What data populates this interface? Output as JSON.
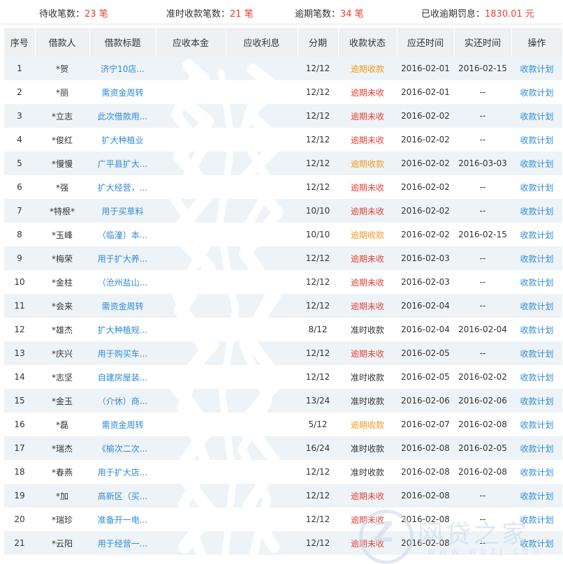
{
  "summary": {
    "pending_label": "待收笔数：",
    "pending_value": "23 笔",
    "ontime_label": "准时收款笔数：",
    "ontime_value": "21 笔",
    "overdue_label": "逾期笔数：",
    "overdue_value": "34 笔",
    "penalty_label": "已收逾期罚息：",
    "penalty_value": "1830.01 元"
  },
  "table": {
    "headers": [
      "序号",
      "借款人",
      "借款标题",
      "应收本金",
      "应收利息",
      "分期",
      "收款状态",
      "应还时间",
      "实还时间",
      "操作"
    ],
    "rows": [
      {
        "no": "1",
        "borrower": "*贺",
        "title": "济宁10店...",
        "principal": "",
        "interest": "",
        "term": "12/12",
        "status": "逾期收款",
        "status_kind": "overdue-paid",
        "due": "2016-02-01",
        "paid": "2016-02-15",
        "action": "收款计划"
      },
      {
        "no": "2",
        "borrower": "*丽",
        "title": "需资金周转",
        "principal": "",
        "interest": "",
        "term": "12/12",
        "status": "逾期未收",
        "status_kind": "overdue-unpaid",
        "due": "2016-02-01",
        "paid": "--",
        "action": "收款计划"
      },
      {
        "no": "3",
        "borrower": "*立志",
        "title": "此次借款用...",
        "principal": "",
        "interest": "",
        "term": "12/12",
        "status": "逾期未收",
        "status_kind": "overdue-unpaid",
        "due": "2016-02-02",
        "paid": "--",
        "action": "收款计划"
      },
      {
        "no": "4",
        "borrower": "*俊红",
        "title": "扩大种植业",
        "principal": "",
        "interest": "",
        "term": "12/12",
        "status": "逾期未收",
        "status_kind": "overdue-unpaid",
        "due": "2016-02-02",
        "paid": "--",
        "action": "收款计划"
      },
      {
        "no": "5",
        "borrower": "*慢慢",
        "title": "广平县扩大...",
        "principal": "",
        "interest": "",
        "term": "12/12",
        "status": "逾期收款",
        "status_kind": "overdue-paid",
        "due": "2016-02-02",
        "paid": "2016-03-03",
        "action": "收款计划"
      },
      {
        "no": "6",
        "borrower": "*强",
        "title": "扩大经营，...",
        "principal": "",
        "interest": "",
        "term": "12/12",
        "status": "逾期未收",
        "status_kind": "overdue-unpaid",
        "due": "2016-02-02",
        "paid": "--",
        "action": "收款计划"
      },
      {
        "no": "7",
        "borrower": "*特根*",
        "title": "用于买草料",
        "principal": "",
        "interest": "",
        "term": "10/10",
        "status": "逾期未收",
        "status_kind": "overdue-unpaid",
        "due": "2016-02-02",
        "paid": "--",
        "action": "收款计划"
      },
      {
        "no": "8",
        "borrower": "*玉峰",
        "title": "（临潼）本...",
        "principal": "",
        "interest": "",
        "term": "10/10",
        "status": "逾期收款",
        "status_kind": "overdue-paid",
        "due": "2016-02-02",
        "paid": "2016-02-15",
        "action": "收款计划"
      },
      {
        "no": "9",
        "borrower": "*梅荣",
        "title": "用于扩大养...",
        "principal": "",
        "interest": "",
        "term": "12/12",
        "status": "逾期未收",
        "status_kind": "overdue-unpaid",
        "due": "2016-02-03",
        "paid": "--",
        "action": "收款计划"
      },
      {
        "no": "10",
        "borrower": "*金柱",
        "title": "（沧州盐山...",
        "principal": "",
        "interest": "",
        "term": "12/12",
        "status": "逾期未收",
        "status_kind": "overdue-unpaid",
        "due": "2016-02-03",
        "paid": "--",
        "action": "收款计划"
      },
      {
        "no": "11",
        "borrower": "*会来",
        "title": "需资金周转",
        "principal": "",
        "interest": "",
        "term": "12/12",
        "status": "逾期未收",
        "status_kind": "overdue-unpaid",
        "due": "2016-02-04",
        "paid": "--",
        "action": "收款计划"
      },
      {
        "no": "12",
        "borrower": "*雄杰",
        "title": "扩大种植规...",
        "principal": "",
        "interest": "",
        "term": "8/12",
        "status": "准时收款",
        "status_kind": "ontime",
        "due": "2016-02-04",
        "paid": "2016-02-04",
        "action": "收款计划"
      },
      {
        "no": "13",
        "borrower": "*庆兴",
        "title": "用于购买车...",
        "principal": "",
        "interest": "",
        "term": "12/12",
        "status": "逾期未收",
        "status_kind": "overdue-unpaid",
        "due": "2016-02-05",
        "paid": "--",
        "action": "收款计划"
      },
      {
        "no": "14",
        "borrower": "*志坚",
        "title": "自建房屋装...",
        "principal": "",
        "interest": "",
        "term": "12/12",
        "status": "准时收款",
        "status_kind": "ontime",
        "due": "2016-02-05",
        "paid": "2016-02-02",
        "action": "收款计划"
      },
      {
        "no": "15",
        "borrower": "*金玉",
        "title": "（介休）商...",
        "principal": "",
        "interest": "",
        "term": "13/24",
        "status": "准时收款",
        "status_kind": "ontime",
        "due": "2016-02-06",
        "paid": "2016-02-06",
        "action": "收款计划"
      },
      {
        "no": "16",
        "borrower": "*磊",
        "title": "需资金周转",
        "principal": "",
        "interest": "",
        "term": "5/12",
        "status": "逾期收款",
        "status_kind": "overdue-paid",
        "due": "2016-02-07",
        "paid": "2016-02-08",
        "action": "收款计划"
      },
      {
        "no": "17",
        "borrower": "*瑞杰",
        "title": "《榆次二次...",
        "principal": "",
        "interest": "",
        "term": "16/24",
        "status": "准时收款",
        "status_kind": "ontime",
        "due": "2016-02-08",
        "paid": "2016-02-05",
        "action": "收款计划"
      },
      {
        "no": "18",
        "borrower": "*春燕",
        "title": "用于扩大店...",
        "principal": "",
        "interest": "",
        "term": "12/12",
        "status": "准时收款",
        "status_kind": "ontime",
        "due": "2016-02-08",
        "paid": "2016-02-08",
        "action": "收款计划"
      },
      {
        "no": "19",
        "borrower": "*加",
        "title": "高新区（买...",
        "principal": "",
        "interest": "",
        "term": "12/12",
        "status": "逾期未收",
        "status_kind": "overdue-unpaid",
        "due": "2016-02-08",
        "paid": "--",
        "action": "收款计划"
      },
      {
        "no": "20",
        "borrower": "*瑞珍",
        "title": "准备开一电...",
        "principal": "",
        "interest": "",
        "term": "12/12",
        "status": "逾期未收",
        "status_kind": "overdue-unpaid",
        "due": "2016-02-08",
        "paid": "--",
        "action": "收款计划"
      },
      {
        "no": "21",
        "borrower": "*云阳",
        "title": "用于经营一...",
        "principal": "",
        "interest": "",
        "term": "12/12",
        "status": "逾期未收",
        "status_kind": "overdue-unpaid",
        "due": "2016-02-08",
        "paid": "--",
        "action": "收款计划"
      }
    ]
  },
  "watermark": {
    "text": "网贷之家",
    "sub": "WWW.WDZJ.COM",
    "color": "#c9d7ea"
  },
  "colors": {
    "overdue_paid": "#f39a1e",
    "overdue_unpaid": "#e0433b",
    "link": "#2f8ad6",
    "header_bg": "#eef0f2",
    "row_alt_bg": "#eef3f7"
  }
}
